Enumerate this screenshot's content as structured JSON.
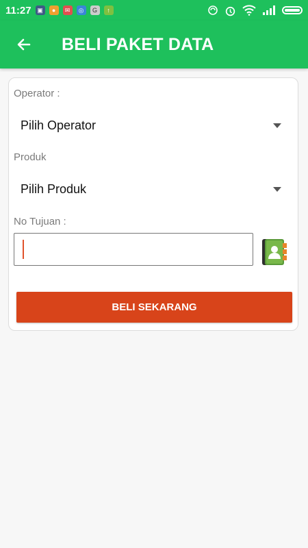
{
  "status_bar": {
    "time": "11:27"
  },
  "app_bar": {
    "title": "BELI PAKET DATA",
    "back_icon": "arrow-left-icon"
  },
  "form": {
    "operator_label": "Operator :",
    "operator_value": "Pilih Operator",
    "produk_label": "Produk",
    "produk_value": "Pilih Produk",
    "tujuan_label": "No Tujuan :",
    "tujuan_value": "",
    "contact_icon": "contact-book-icon",
    "buy_button_label": "BELI SEKARANG"
  },
  "colors": {
    "primary": "#1ec05c",
    "button": "#d8441a",
    "background": "#f7f7f7"
  }
}
